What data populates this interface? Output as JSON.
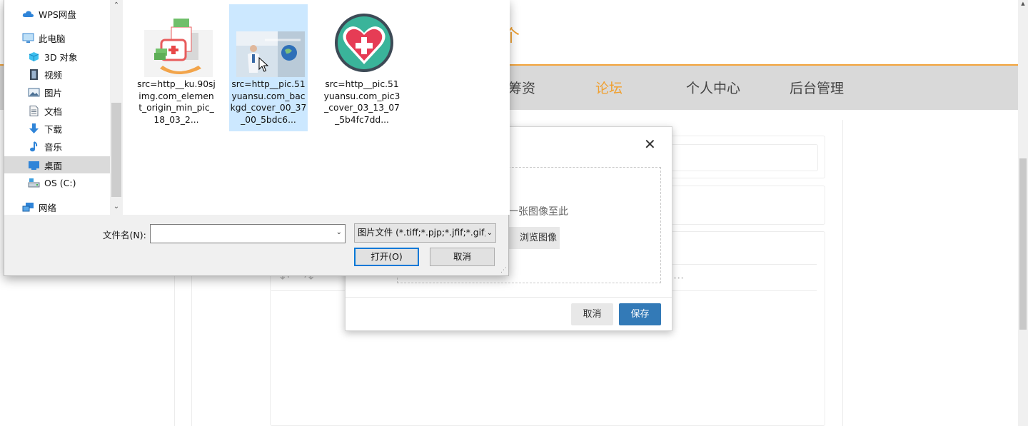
{
  "site": {
    "logo_fragment": "个",
    "nav": [
      {
        "label": "筹资",
        "active": false
      },
      {
        "label": "论坛",
        "active": true
      },
      {
        "label": "个人中心",
        "active": false
      },
      {
        "label": "后台管理",
        "active": false
      }
    ]
  },
  "modal": {
    "close": "✕",
    "drop_text": "一张图像至此",
    "browse_label": "浏览图像",
    "cancel_label": "取消",
    "save_label": "保存"
  },
  "file_dialog": {
    "tree": [
      {
        "label": "WPS网盘",
        "icon": "cloud-icon",
        "selected": false
      },
      {
        "label": "此电脑",
        "icon": "computer-icon",
        "selected": false
      },
      {
        "label": "3D 对象",
        "icon": "cube-icon",
        "selected": false
      },
      {
        "label": "视频",
        "icon": "video-icon",
        "selected": false
      },
      {
        "label": "图片",
        "icon": "picture-icon",
        "selected": false
      },
      {
        "label": "文档",
        "icon": "document-icon",
        "selected": false
      },
      {
        "label": "下载",
        "icon": "download-icon",
        "selected": false
      },
      {
        "label": "音乐",
        "icon": "music-icon",
        "selected": false
      },
      {
        "label": "桌面",
        "icon": "desktop-icon",
        "selected": true
      },
      {
        "label": "OS (C:)",
        "icon": "drive-icon",
        "selected": false
      },
      {
        "label": "网络",
        "icon": "network-icon",
        "selected": false
      }
    ],
    "files": [
      {
        "name": "src=http__ku.90sjimg.com_element_origin_min_pic_18_03_2...",
        "thumb": "medical-kit-thumb",
        "selected": false
      },
      {
        "name": "src=http__pic.51yuansu.com_backgd_cover_00_37_00_5bdc6...",
        "thumb": "doctor-globe-thumb",
        "selected": true
      },
      {
        "name": "src=http__pic.51yuansu.com_pic3_cover_03_13_07_5b4fc7dd...",
        "thumb": "heart-cross-thumb",
        "selected": false
      }
    ],
    "filename_label": "文件名(N):",
    "filename_value": "",
    "filetype_value": "图片文件 (*.tiff;*.pjp;*.jfif;*.gif;",
    "open_label": "打开(O)",
    "cancel_label": "取消"
  }
}
